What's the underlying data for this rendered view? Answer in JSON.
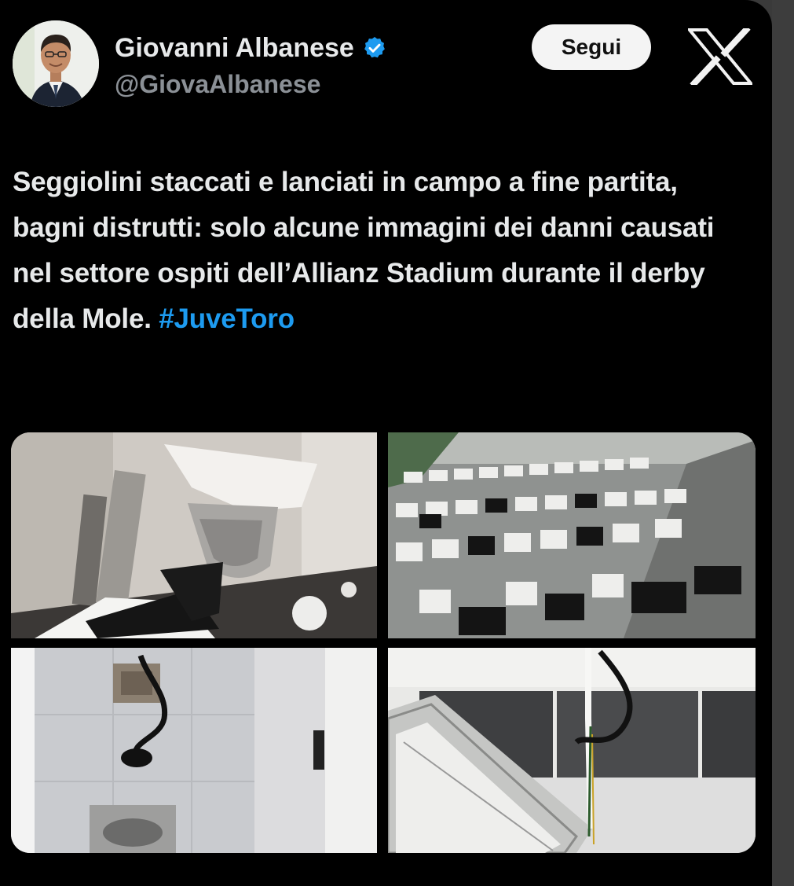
{
  "author": {
    "name": "Giovanni Albanese",
    "handle": "@GiovaAlbanese",
    "verified": true
  },
  "follow_label": "Segui",
  "platform_logo": "x-logo-icon",
  "tweet": {
    "text": "Seggiolini staccati e lanciati in campo a fine partita, bagni distrutti: solo alcune immagini dei danni causati nel settore ospiti dell’Allianz Stadium durante il derby della Mole.",
    "hashtag": "#JuveToro"
  },
  "colors": {
    "background": "#000000",
    "text": "#e7e9ea",
    "handle": "#8b9096",
    "link": "#1d9bf0",
    "verified": "#1d9bf0",
    "follow_bg": "#f4f4f4"
  },
  "media": [
    {
      "name": "photo-broken-toilet"
    },
    {
      "name": "photo-stadium-seats"
    },
    {
      "name": "photo-bathroom-wall"
    },
    {
      "name": "photo-ceiling-light"
    }
  ]
}
